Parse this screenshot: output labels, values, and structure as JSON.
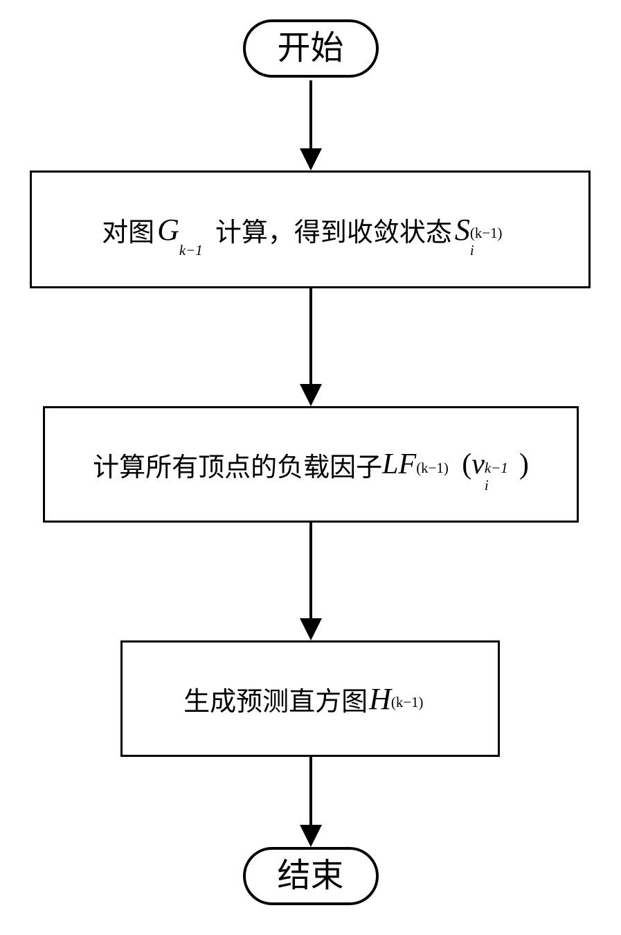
{
  "flowchart": {
    "start": "开始",
    "end": "结束",
    "step1": {
      "part1": "对图 ",
      "sym_G": "G",
      "sub_k1a": "k−1",
      "part2": " 计算，得到收敛状态 ",
      "sym_S": "S",
      "sub_i": "i",
      "sup_k1": "(k−1)"
    },
    "step2": {
      "part1": "计算所有顶点的负载因子",
      "sym_LF": "LF",
      "sup_k1a": "(k−1)",
      "paren_open": "(",
      "sym_v": "v",
      "sub_i": "i",
      "sup_k1b": "k−1",
      "paren_close": ")"
    },
    "step3": {
      "part1": "生成预测直方图",
      "sym_H": "H",
      "sup_k1": "(k−1)"
    }
  }
}
